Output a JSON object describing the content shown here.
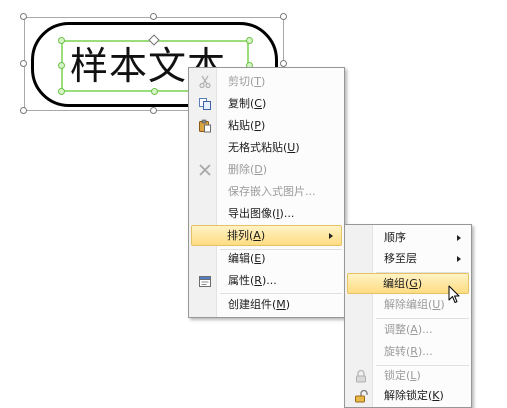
{
  "shape": {
    "text": "样本文本"
  },
  "context_menu": {
    "items": [
      {
        "id": "cut",
        "label": "剪切(T)",
        "enabled": false,
        "icon": "scissors-icon"
      },
      {
        "id": "copy",
        "label": "复制(C)",
        "enabled": true,
        "icon": "copy-icon"
      },
      {
        "id": "paste",
        "label": "粘贴(P)",
        "enabled": true,
        "icon": "paste-icon"
      },
      {
        "id": "paste_plain",
        "label": "无格式粘贴(U)",
        "enabled": true
      },
      {
        "id": "delete",
        "label": "删除(D)",
        "enabled": false,
        "icon": "delete-x-icon"
      },
      {
        "id": "save_embedded",
        "label": "保存嵌入式图片...",
        "enabled": false
      },
      {
        "id": "export_image",
        "label": "导出图像(I)...",
        "enabled": true
      },
      {
        "id": "arrange",
        "label": "排列(A)",
        "enabled": true,
        "highlighted": true,
        "has_submenu": true
      },
      {
        "id": "edit",
        "label": "编辑(E)",
        "enabled": true
      },
      {
        "id": "properties",
        "label": "属性(R)...",
        "enabled": true,
        "icon": "properties-icon"
      },
      {
        "id": "create_component",
        "label": "创建组件(M)",
        "enabled": true
      }
    ]
  },
  "submenu": {
    "items": [
      {
        "id": "order",
        "label": "顺序",
        "enabled": true,
        "has_submenu": true
      },
      {
        "id": "move_to_layer",
        "label": "移至层",
        "enabled": true,
        "has_submenu": true
      },
      {
        "id": "group",
        "label": "编组(G)",
        "enabled": true,
        "highlighted": true
      },
      {
        "id": "ungroup",
        "label": "解除编组(U)",
        "enabled": false
      },
      {
        "id": "adjust",
        "label": "调整(A)...",
        "enabled": false
      },
      {
        "id": "rotate",
        "label": "旋转(R)...",
        "enabled": false
      },
      {
        "id": "lock",
        "label": "锁定(L)",
        "enabled": false,
        "icon": "lock-icon"
      },
      {
        "id": "unlock",
        "label": "解除锁定(K)",
        "enabled": true,
        "icon": "unlock-icon"
      }
    ]
  }
}
